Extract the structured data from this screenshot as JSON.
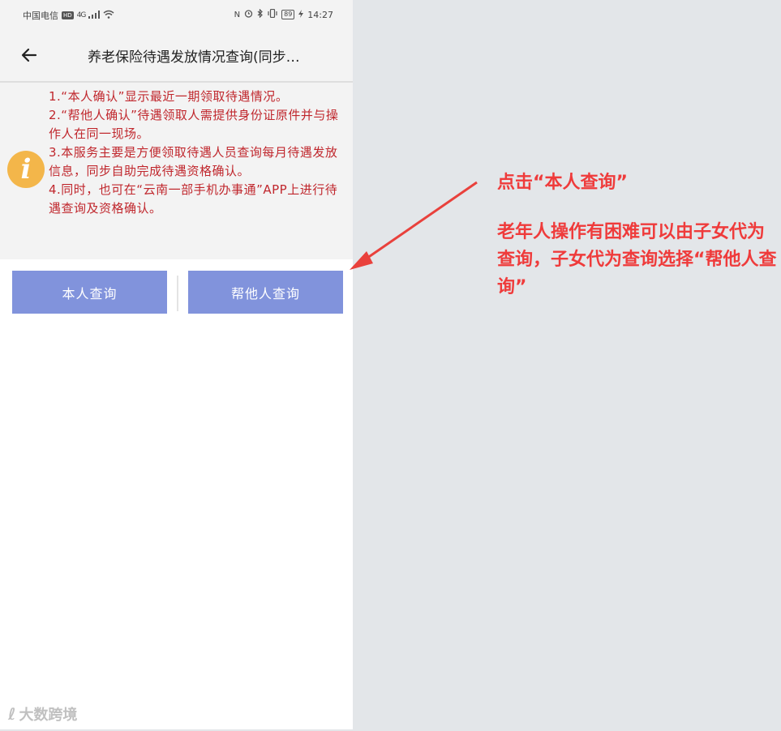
{
  "status_bar": {
    "carrier": "中国电信",
    "hd": "HD",
    "signal": "4G",
    "nfc": "N",
    "battery": "89",
    "time": "14:27"
  },
  "header": {
    "title": "养老保险待遇发放情况查询(同步…"
  },
  "notice": {
    "lines": [
      "1.“本人确认”显示最近一期领取待遇情况。",
      "2.“帮他人确认”待遇领取人需提供身份证原件并与操作人在同一现场。",
      "3.本服务主要是方便领取待遇人员查询每月待遇发放信息，同步自助完成待遇资格确认。",
      "4.同时，也可在“云南一部手机办事通”APP上进行待遇查询及资格确认。"
    ]
  },
  "buttons": {
    "self_query": "本人查询",
    "other_query": "帮他人查询"
  },
  "annotation": {
    "line1": "点击“本人查询”",
    "line2": "老年人操作有困难可以由子女代为查询，子女代为查询选择“帮他人查询”"
  },
  "watermark": {
    "logo": "ℓ",
    "text": "大数跨境"
  },
  "colors": {
    "notice_text": "#c0272d",
    "button": "#8193dc",
    "annotation": "#ef3b3b",
    "info_icon": "#f3b64a"
  },
  "icons": [
    "back-arrow-icon",
    "info-icon",
    "wifi-icon",
    "bluetooth-icon",
    "alarm-icon",
    "vibrate-icon",
    "battery-icon"
  ]
}
